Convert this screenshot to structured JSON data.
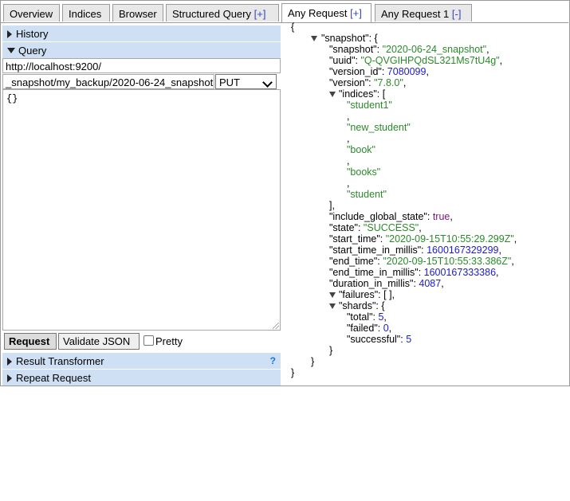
{
  "tabs": [
    {
      "label": "Overview"
    },
    {
      "label": "Indices"
    },
    {
      "label": "Browser"
    },
    {
      "label": "Structured Query",
      "ctl": "[+]"
    },
    {
      "label": "Any Request",
      "ctl": "[+]"
    },
    {
      "label": "Any Request 1",
      "ctl": "[-]"
    }
  ],
  "left": {
    "history_label": "History",
    "query_label": "Query",
    "host_value": "http://localhost:9200/",
    "path_value": "_snapshot/my_backup/2020-06-24_snapshot",
    "method_selected": "PUT",
    "body_value": "{}",
    "request_button": "Request",
    "validate_button": "Validate JSON",
    "pretty_label": "Pretty",
    "result_transformer_label": "Result Transformer",
    "result_help": "?",
    "repeat_request_label": "Repeat Request"
  },
  "response": {
    "open_brace": "{",
    "close_brace": "}",
    "snapshot_key": "\"snapshot\": {",
    "snapshot": {
      "snapshot": "\"2020-06-24_snapshot\"",
      "uuid": "\"Q-QVGIHPQdSL321Ms7tU4g\"",
      "version_id": "7080099",
      "version": "\"7.8.0\"",
      "indices": [
        "\"student1\"",
        "\"new_student\"",
        "\"book\"",
        "\"books\"",
        "\"student\""
      ],
      "include_global_state": "true",
      "state": "\"SUCCESS\"",
      "start_time": "\"2020-09-15T10:55:29.299Z\"",
      "start_time_in_millis": "1600167329299",
      "end_time": "\"2020-09-15T10:55:33.386Z\"",
      "end_time_in_millis": "1600167333386",
      "duration_in_millis": "4087",
      "failures": "[ ],",
      "shards": {
        "total": "5",
        "failed": "0",
        "successful": "5"
      }
    }
  },
  "colors": {
    "string": "#2a8a2a",
    "number": "#1b1bd1",
    "boolean": "#7a1a7a",
    "accent_bar": "#cfe0f5"
  }
}
